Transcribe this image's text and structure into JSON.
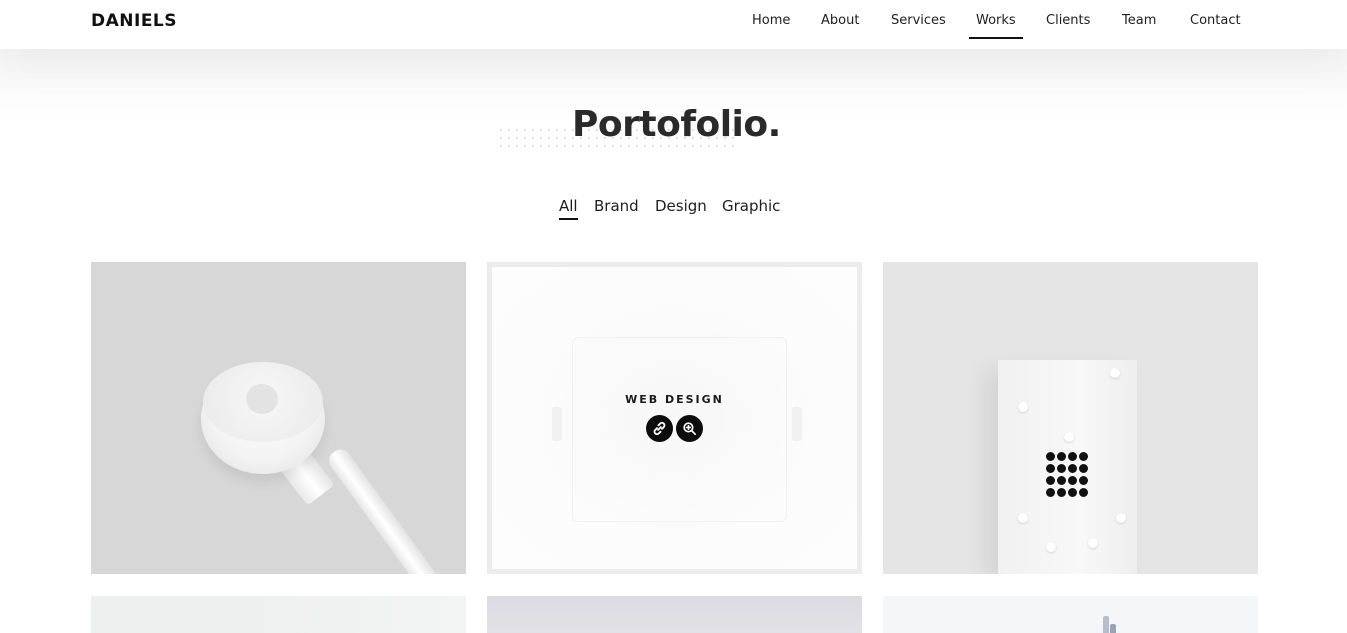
{
  "header": {
    "brand": "DANIELS",
    "nav": [
      {
        "label": "Home",
        "active": false
      },
      {
        "label": "About",
        "active": false
      },
      {
        "label": "Services",
        "active": false
      },
      {
        "label": "Works",
        "active": true
      },
      {
        "label": "Clients",
        "active": false
      },
      {
        "label": "Team",
        "active": false
      },
      {
        "label": "Contact",
        "active": false
      }
    ]
  },
  "portfolio": {
    "title": "Portofolio.",
    "filters": [
      {
        "label": "All",
        "active": true
      },
      {
        "label": "Brand",
        "active": false
      },
      {
        "label": "Design",
        "active": false
      },
      {
        "label": "Graphic",
        "active": false
      }
    ],
    "hovered_item": {
      "caption": "WEB DESIGN",
      "actions": [
        "link-icon",
        "zoom-icon"
      ]
    }
  },
  "colors": {
    "accent": "#111111",
    "text": "#1e1e1e"
  }
}
